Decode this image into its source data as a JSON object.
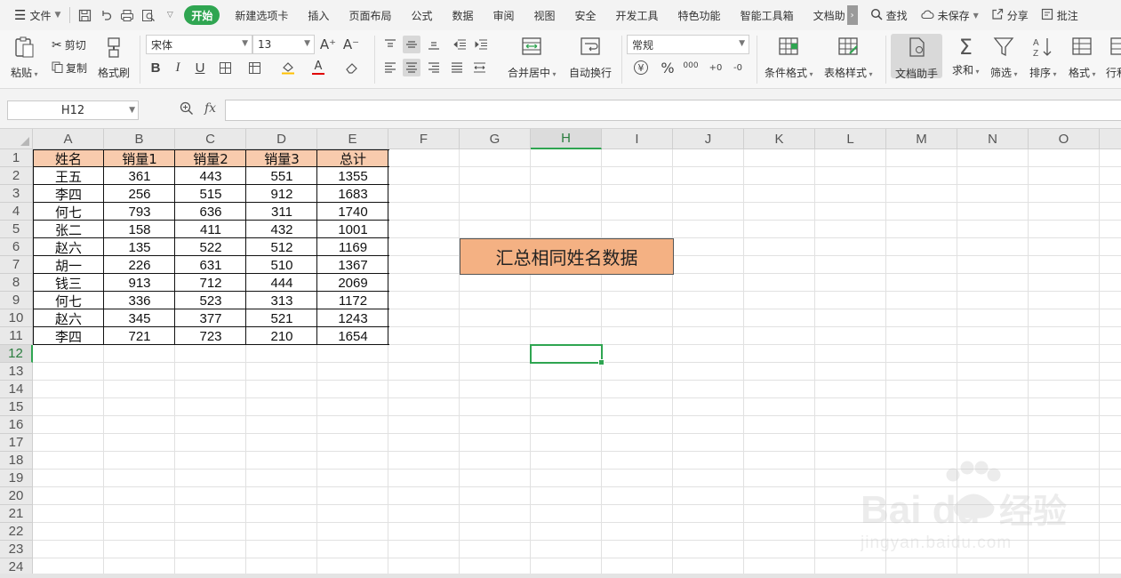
{
  "menubar": {
    "file_label": "文件",
    "tabs": [
      "开始",
      "新建选项卡",
      "插入",
      "页面布局",
      "公式",
      "数据",
      "审阅",
      "视图",
      "安全",
      "开发工具",
      "特色功能",
      "智能工具箱",
      "文档助"
    ],
    "active_tab_index": 0,
    "search_label": "查找",
    "unsaved_label": "未保存",
    "share_label": "分享",
    "comment_label": "批注"
  },
  "ribbon": {
    "paste": "粘贴",
    "cut": "剪切",
    "copy": "复制",
    "format_painter": "格式刷",
    "font_name": "宋体",
    "font_size": "13",
    "grow_font": "A⁺",
    "shrink_font": "A⁻",
    "bold": "B",
    "italic": "I",
    "underline": "U",
    "font_color_glyph": "A",
    "merge_center": "合并居中",
    "wrap_text": "自动换行",
    "number_format": "常规",
    "currency_glyph": "¥",
    "percent_glyph": "%",
    "thousands_glyph": "000",
    "inc_decimal_glyph": "+0",
    "dec_decimal_glyph": "-0",
    "conditional_format": "条件格式",
    "table_style": "表格样式",
    "doc_helper": "文档助手",
    "sum": "求和",
    "filter": "筛选",
    "sort": "排序",
    "format": "格式",
    "row_col": "行和"
  },
  "formula_bar": {
    "name_box": "H12",
    "fx_label": "fx",
    "formula": ""
  },
  "sheet": {
    "columns": [
      "A",
      "B",
      "C",
      "D",
      "E",
      "F",
      "G",
      "H",
      "I",
      "J",
      "K",
      "L",
      "M",
      "N",
      "O"
    ],
    "rows": [
      "1",
      "2",
      "3",
      "4",
      "5",
      "6",
      "7",
      "8",
      "9",
      "10",
      "11",
      "12",
      "13",
      "14",
      "15",
      "16",
      "17",
      "18",
      "19",
      "20",
      "21",
      "22",
      "23",
      "24"
    ],
    "selected_column": "H",
    "selected_row": "12",
    "table": {
      "headers": [
        "姓名",
        "销量1",
        "销量2",
        "销量3",
        "总计"
      ],
      "rows": [
        [
          "王五",
          "361",
          "443",
          "551",
          "1355"
        ],
        [
          "李四",
          "256",
          "515",
          "912",
          "1683"
        ],
        [
          "何七",
          "793",
          "636",
          "311",
          "1740"
        ],
        [
          "张二",
          "158",
          "411",
          "432",
          "1001"
        ],
        [
          "赵六",
          "135",
          "522",
          "512",
          "1169"
        ],
        [
          "胡一",
          "226",
          "631",
          "510",
          "1367"
        ],
        [
          "钱三",
          "913",
          "712",
          "444",
          "2069"
        ],
        [
          "何七",
          "336",
          "523",
          "313",
          "1172"
        ],
        [
          "赵六",
          "345",
          "377",
          "521",
          "1243"
        ],
        [
          "李四",
          "721",
          "723",
          "210",
          "1654"
        ]
      ]
    },
    "summary_button": "汇总相同姓名数据",
    "header_fill_color": "#f8cbad",
    "button_fill_color": "#f4b183",
    "accent_color": "#2fa551"
  },
  "watermark": {
    "brand": "Bai du",
    "cn": "经验",
    "url": "jingyan.baidu.com"
  }
}
